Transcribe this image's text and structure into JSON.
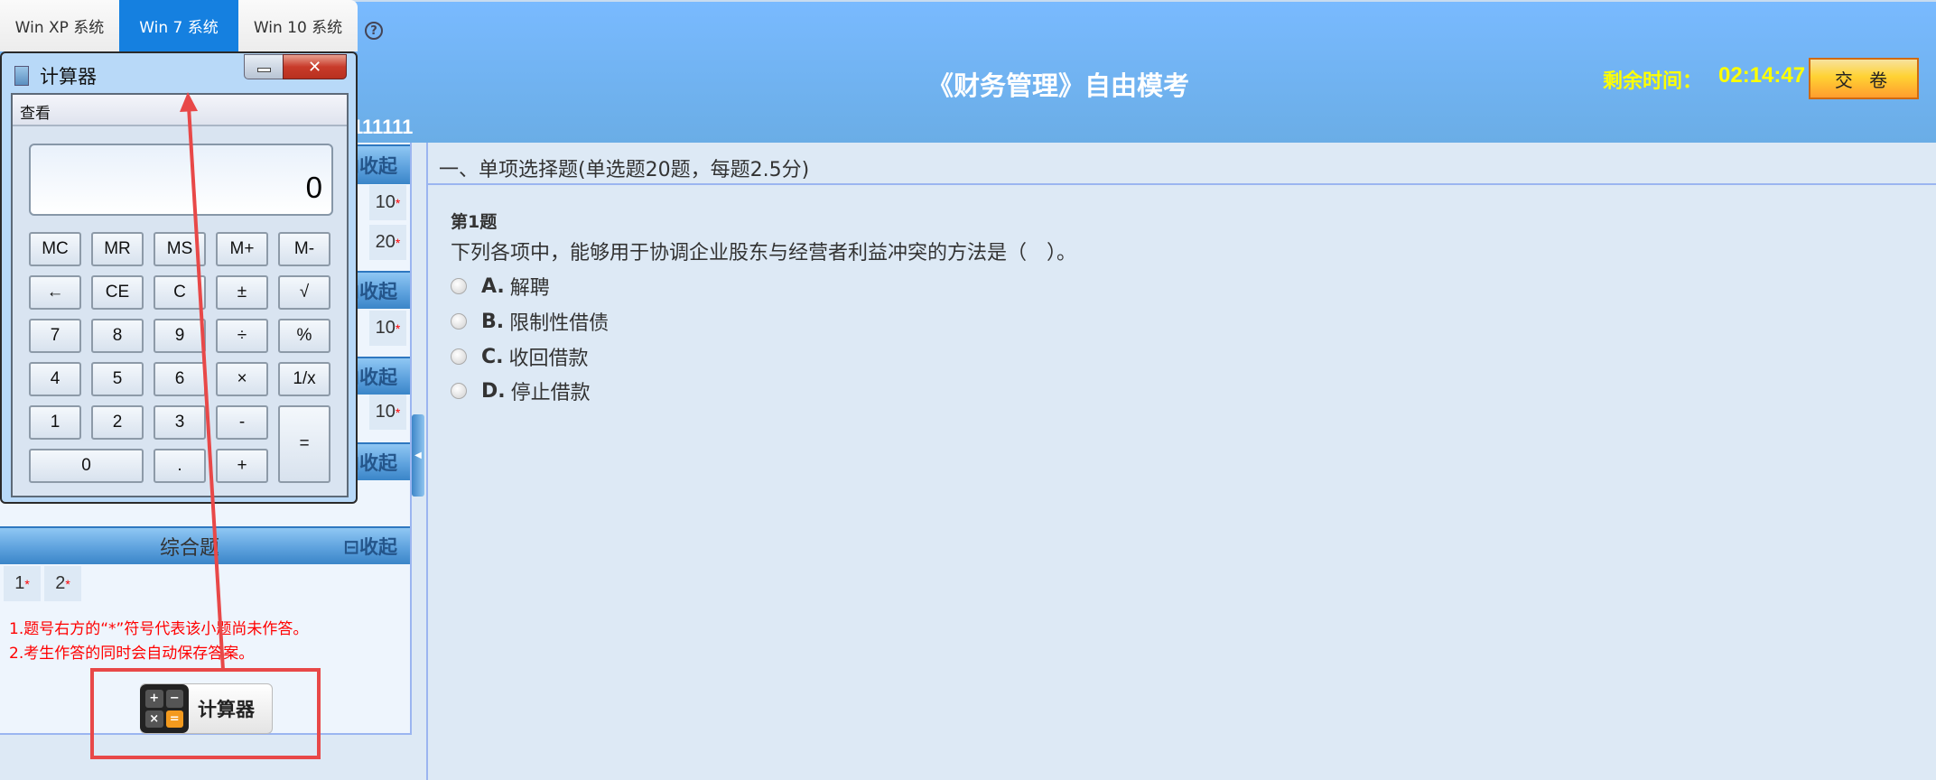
{
  "tabs": [
    {
      "label": "Win XP 系统",
      "active": false
    },
    {
      "label": "Win 7 系统",
      "active": true
    },
    {
      "label": "Win 10 系统",
      "active": false
    }
  ],
  "help_icon": "?",
  "header": {
    "title": "《财务管理》自由模考",
    "timer_label": "剩余时间：",
    "timer": "02:14:47",
    "submit_label": "交 卷",
    "user_id": "111111"
  },
  "sidebar": {
    "collapse_label": "⊟收起",
    "sections": [
      {
        "title": "",
        "cells": [
          {
            "n": "",
            "y": 0,
            "col": 9,
            "label": "10"
          },
          {
            "n": "",
            "y": 1,
            "col": 9,
            "label": "20"
          }
        ]
      },
      {
        "title": "",
        "cells": [
          {
            "y": 0,
            "col": 9,
            "label": "10"
          }
        ]
      },
      {
        "title": "",
        "cells": [
          {
            "y": 0,
            "col": 9,
            "label": "10"
          }
        ]
      },
      {
        "title": "",
        "cells": []
      },
      {
        "title": "综合题",
        "cells": [
          {
            "y": 0,
            "col": 0,
            "label": "1"
          },
          {
            "y": 0,
            "col": 1,
            "label": "2"
          }
        ]
      }
    ],
    "star": "*",
    "notes": [
      "1.题号右方的“*”符号代表该小题尚未作答。",
      "2.考生作答的同时会自动保存答案。"
    ],
    "calculator_button": "计算器"
  },
  "main": {
    "section_title": "一、单项选择题(单选题20题，每题2.5分)",
    "question_no": "第1题",
    "question_text": "下列各项中，能够用于协调企业股东与经营者利益冲突的方法是（　）。",
    "options": [
      {
        "key": "A.",
        "text": "解聘"
      },
      {
        "key": "B.",
        "text": "限制性借债"
      },
      {
        "key": "C.",
        "text": "收回借款"
      },
      {
        "key": "D.",
        "text": "停止借款"
      }
    ]
  },
  "calculator": {
    "title": "计算器",
    "menu": "查看",
    "display": "0",
    "close": "✕",
    "keys": [
      [
        "MC",
        "MR",
        "MS",
        "M+",
        "M-"
      ],
      [
        "←",
        "CE",
        "C",
        "±",
        "√"
      ],
      [
        "7",
        "8",
        "9",
        "÷",
        "%"
      ],
      [
        "4",
        "5",
        "6",
        "×",
        "1/x"
      ],
      [
        "1",
        "2",
        "3",
        "-",
        "="
      ],
      [
        "0",
        ".",
        "+"
      ]
    ]
  },
  "colors": {
    "header": "#79baff",
    "accent_tab": "#1580e0",
    "timer": "#ffff00",
    "annotation": "#e84848"
  }
}
